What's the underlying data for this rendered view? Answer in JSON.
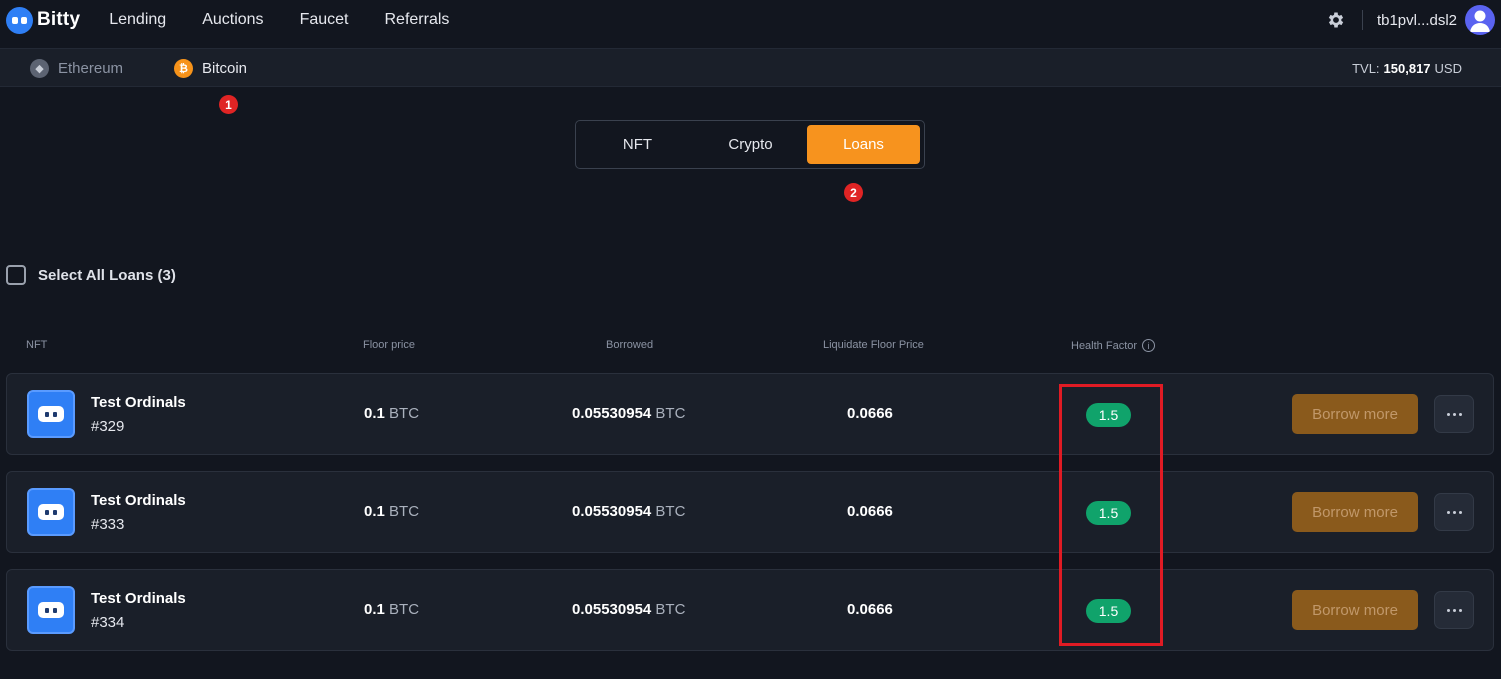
{
  "brand": {
    "name": "Bitty"
  },
  "nav": {
    "items": [
      "Lending",
      "Auctions",
      "Faucet",
      "Referrals"
    ]
  },
  "account": {
    "wallet": "tb1pvl...dsl2"
  },
  "networks": {
    "ethereum": "Ethereum",
    "bitcoin": "Bitcoin",
    "selected": "Bitcoin"
  },
  "tvl": {
    "label": "TVL:",
    "value": "150,817",
    "unit": "USD"
  },
  "markers": [
    "1",
    "2"
  ],
  "segment": {
    "tabs": [
      "NFT",
      "Crypto",
      "Loans"
    ],
    "active": "Loans"
  },
  "select_all": {
    "label": "Select All Loans (3)"
  },
  "table": {
    "headers": {
      "nft": "NFT",
      "floor": "Floor price",
      "borrowed": "Borrowed",
      "liquidate": "Liquidate Floor Price",
      "health": "Health Factor"
    },
    "rows": [
      {
        "name": "Test Ordinals",
        "id": "#329",
        "floor": "0.1",
        "floor_unit": "BTC",
        "borrowed": "0.05530954",
        "borrowed_unit": "BTC",
        "liquidate": "0.0666",
        "health": "1.5",
        "action": "Borrow more"
      },
      {
        "name": "Test Ordinals",
        "id": "#333",
        "floor": "0.1",
        "floor_unit": "BTC",
        "borrowed": "0.05530954",
        "borrowed_unit": "BTC",
        "liquidate": "0.0666",
        "health": "1.5",
        "action": "Borrow more"
      },
      {
        "name": "Test Ordinals",
        "id": "#334",
        "floor": "0.1",
        "floor_unit": "BTC",
        "borrowed": "0.05530954",
        "borrowed_unit": "BTC",
        "liquidate": "0.0666",
        "health": "1.5",
        "action": "Borrow more"
      }
    ]
  },
  "colors": {
    "accent": "#f7931e",
    "health_good": "#10a36b",
    "highlight": "#e01b24",
    "background": "#12161f"
  },
  "icons": [
    "bitty-logo-icon",
    "gear-icon",
    "user-avatar-icon",
    "ethereum-icon",
    "bitcoin-icon",
    "info-icon",
    "nft-thumbnail-icon",
    "more-options-icon"
  ]
}
